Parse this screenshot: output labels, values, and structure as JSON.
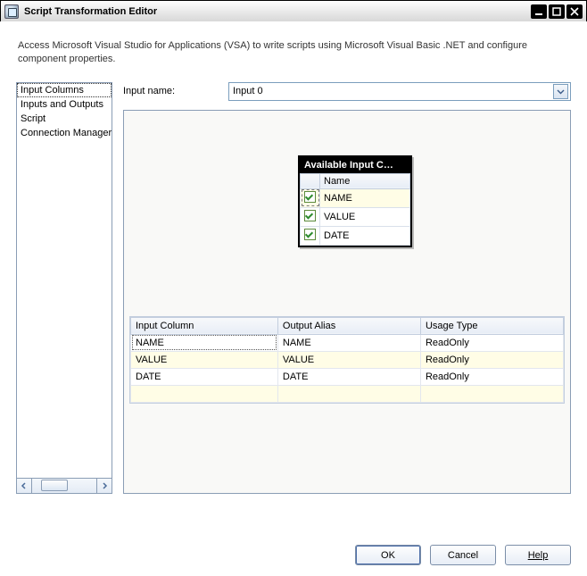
{
  "window": {
    "title": "Script Transformation Editor"
  },
  "description": "Access Microsoft Visual Studio for Applications (VSA) to write scripts using Microsoft Visual Basic .NET and configure component properties.",
  "nav": {
    "items": [
      {
        "label": "Input Columns",
        "selected": true
      },
      {
        "label": "Inputs and Outputs",
        "selected": false
      },
      {
        "label": "Script",
        "selected": false
      },
      {
        "label": "Connection Managers",
        "selected": false
      }
    ]
  },
  "input_name": {
    "label": "Input name:",
    "value": "Input 0"
  },
  "available_columns": {
    "header": "Available Input C…",
    "name_col": "Name",
    "rows": [
      {
        "name": "NAME",
        "checked": true,
        "selected": true
      },
      {
        "name": "VALUE",
        "checked": true,
        "selected": false
      },
      {
        "name": "DATE",
        "checked": true,
        "selected": false
      }
    ]
  },
  "grid": {
    "cols": {
      "c1": "Input Column",
      "c2": "Output Alias",
      "c3": "Usage Type"
    },
    "rows": [
      {
        "c1": "NAME",
        "c2": "NAME",
        "c3": "ReadOnly",
        "selected": true,
        "alt": false
      },
      {
        "c1": "VALUE",
        "c2": "VALUE",
        "c3": "ReadOnly",
        "selected": false,
        "alt": true
      },
      {
        "c1": "DATE",
        "c2": "DATE",
        "c3": "ReadOnly",
        "selected": false,
        "alt": false
      }
    ]
  },
  "buttons": {
    "ok": "OK",
    "cancel": "Cancel",
    "help": "Help"
  }
}
